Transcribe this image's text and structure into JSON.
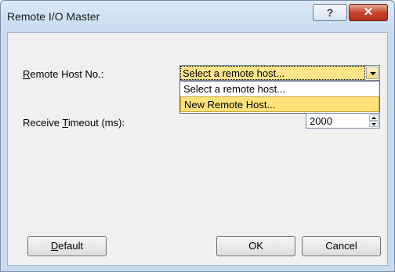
{
  "window": {
    "title": "Remote I/O Master",
    "help_label": "?",
    "close_label": "✕"
  },
  "form": {
    "remote_host_label": "Remote Host No.:",
    "remote_host_access_key": "R",
    "remote_host_rest": "emote Host No.:",
    "remote_host_value": "Select a remote host...",
    "remote_host_options": [
      "Select a remote host...",
      "New Remote Host..."
    ],
    "timeout_label": "Receive Timeout (ms):",
    "timeout_pre": "Receive ",
    "timeout_key": "T",
    "timeout_post": "imeout (ms):",
    "timeout_value": "2000"
  },
  "buttons": {
    "default_key": "D",
    "default_rest": "efault",
    "ok_label": "OK",
    "cancel_label": "Cancel"
  }
}
